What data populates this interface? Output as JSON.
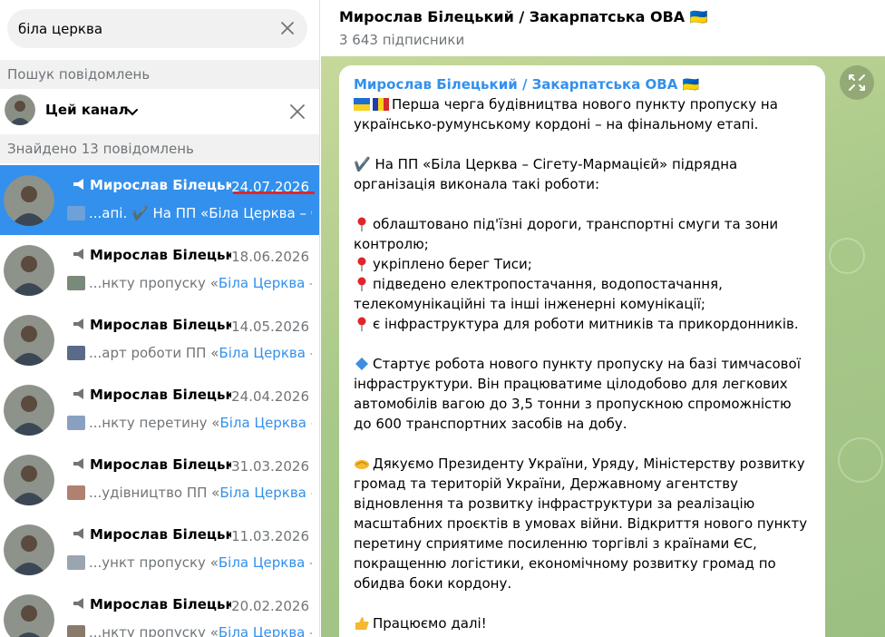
{
  "search": {
    "query": "біла церква"
  },
  "sections": {
    "search_messages": "Пошук повідомлень",
    "found_count": "Знайдено 13 повідомлень"
  },
  "filter": {
    "label": "Цей канал"
  },
  "results": [
    {
      "title": "Мирослав Білецький / Закарпатська ОВА",
      "date": "24.07.2026",
      "pre": "...апі. ",
      "mid": "✔️ На ПП «Біла Церква – Сігету-Мармацієй»",
      "hl": ""
    },
    {
      "title": "Мирослав Білецький / Закарпатська ОВА",
      "date": "18.06.2026",
      "pre": "...нкту пропуску «",
      "mid": "",
      "hl": "Біла Церква – Сігету"
    },
    {
      "title": "Мирослав Білецький / Закарпатська ОВА",
      "date": "14.05.2026",
      "pre": "...арт роботи ПП «",
      "mid": "",
      "hl": "Біла Церква – Сігету"
    },
    {
      "title": "Мирослав Білецький / Закарпатська ОВА",
      "date": "24.04.2026",
      "pre": "...нкту перетину «",
      "mid": "",
      "hl": "Біла Церква – Сігету"
    },
    {
      "title": "Мирослав Білецький / Закарпатська ОВА",
      "date": "31.03.2026",
      "pre": "...удівництво ПП «",
      "mid": "",
      "hl": "Біла Церква – Сігету"
    },
    {
      "title": "Мирослав Білецький / Закарпатська ОВА",
      "date": "11.03.2026",
      "pre": "...ункт пропуску «",
      "mid": "",
      "hl": "Біла Церква – Сігету"
    },
    {
      "title": "Мирослав Білецький / Закарпатська ОВА",
      "date": "20.02.2026",
      "pre": "...нкту пропуску «",
      "mid": "",
      "hl": "Біла Церква – Сігету"
    }
  ],
  "chat": {
    "title": "Мирослав Білецький / Закарпатська ОВА 🇺🇦",
    "subscribers": "3 643 підписники",
    "message": {
      "author": "Мирослав Білецький / Закарпатська ОВА 🇺🇦",
      "p1": "Перша черга будівництва нового пункту пропуску на українсько-румунському кордоні – на фінальному етапі.",
      "p2": "✔️ На ПП «Біла Церква – Сігету-Мармацієй» підрядна організація виконала такі роботи:",
      "b1": "облаштовано під'їзні дороги, транспортні смуги та зони контролю;",
      "b2": "укріплено берег Тиси;",
      "b3": "підведено електропостачання, водопостачання, телекомунікаційні та інші інженерні комунікації;",
      "b4": "є інфраструктура для роботи митників та прикордонників.",
      "p3": "Стартує робота нового пункту пропуску на базі тимчасової інфраструктури. Він працюватиме цілодобово для легкових автомобілів вагою до 3,5 тонни з пропускною спроможністю до 600 транспортних засобів на добу.",
      "p4": "Дякуємо Президенту України, Уряду, Міністерству розвитку громад та територій України, Державному агентству відновлення та розвитку інфраструктури за реалізацію масштабних проєктів в умовах війни. Відкриття нового пункту перетину сприятиме посиленню торгівлі з країнами ЄС, покращенню логістики, економічному розвитку громад по обидва боки кордону.",
      "p5": "Працюємо далі!"
    }
  },
  "colors": {
    "accent": "#3390ec",
    "muted": "#707579",
    "underline": "#e0262a"
  }
}
